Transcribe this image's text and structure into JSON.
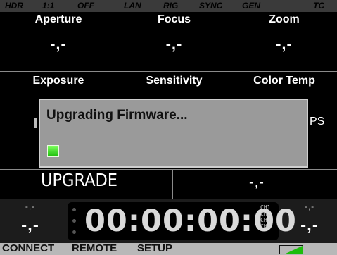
{
  "status_bar": {
    "items": [
      "HDR",
      "1:1",
      "OFF",
      "LAN",
      "RIG",
      "SYNC",
      "GEN",
      "TC"
    ]
  },
  "parameters": {
    "aperture": {
      "label": "Aperture",
      "value": "-,-"
    },
    "focus": {
      "label": "Focus",
      "value": "-,-"
    },
    "zoom": {
      "label": "Zoom",
      "value": "-,-"
    },
    "exposure": {
      "label": "Exposure"
    },
    "sensitivity": {
      "label": "Sensitivity"
    },
    "color_temp": {
      "label": "Color Temp"
    },
    "fps_partial": "PS",
    "mode": "UPGRADE",
    "mode_value": "-,-"
  },
  "dialog": {
    "title": "Upgrading Firmware...",
    "progress_fraction": 0.04
  },
  "timecode": {
    "value": "00:00:00:00",
    "left_top": "-,-",
    "left_bottom": "-,-",
    "right_top": "-,-",
    "right_bottom": "-,-",
    "channels": [
      "CH1",
      "CH2",
      "CH3",
      "CH4"
    ]
  },
  "menu": {
    "items": [
      "CONNECT",
      "REMOTE",
      "SETUP"
    ],
    "battery_icon": "battery-icon",
    "accent": "#1dbd0c"
  }
}
